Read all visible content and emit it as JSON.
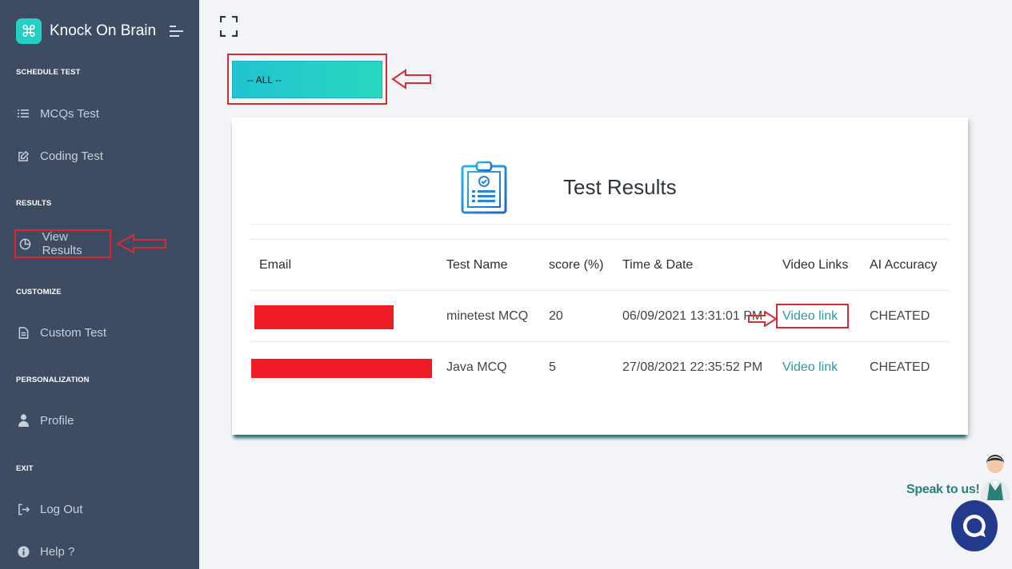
{
  "brand": {
    "logo_glyph": "⌘",
    "name": "Knock On Brain"
  },
  "sidebar": {
    "sections": [
      {
        "label": "SCHEDULE TEST"
      },
      {
        "label": "RESULTS"
      },
      {
        "label": "CUSTOMIZE"
      },
      {
        "label": "PERSONALIZATION"
      },
      {
        "label": "EXIT"
      }
    ],
    "items": [
      {
        "label": "MCQs Test",
        "icon": "list-icon"
      },
      {
        "label": "Coding Test",
        "icon": "edit-icon"
      },
      {
        "label": "View Results",
        "icon": "pie-chart-icon"
      },
      {
        "label": "Custom Test",
        "icon": "document-icon"
      },
      {
        "label": "Profile",
        "icon": "user-icon"
      },
      {
        "label": "Log Out",
        "icon": "logout-icon"
      },
      {
        "label": "Help ?",
        "icon": "info-icon"
      }
    ]
  },
  "filter": {
    "selected": "-- ALL --"
  },
  "results": {
    "title": "Test Results",
    "columns": [
      "Email",
      "Test Name",
      "score (%)",
      "Time & Date",
      "Video Links",
      "AI Accuracy"
    ],
    "rows": [
      {
        "email": "",
        "test_name": "minetest MCQ",
        "score": "20",
        "time": "06/09/2021 13:31:01 PM",
        "video": "Video link",
        "ai": "CHEATED"
      },
      {
        "email": "",
        "test_name": "Java MCQ",
        "score": "5",
        "time": "27/08/2021 22:35:52 PM",
        "video": "Video link",
        "ai": "CHEATED"
      }
    ]
  },
  "support": {
    "label": "Speak to us!"
  },
  "colors": {
    "sidebar": "#3d4b63",
    "accent": "#26cfc6",
    "annotation_red": "#d82b32",
    "link": "#2a9aa0",
    "chat": "#243a8c"
  }
}
